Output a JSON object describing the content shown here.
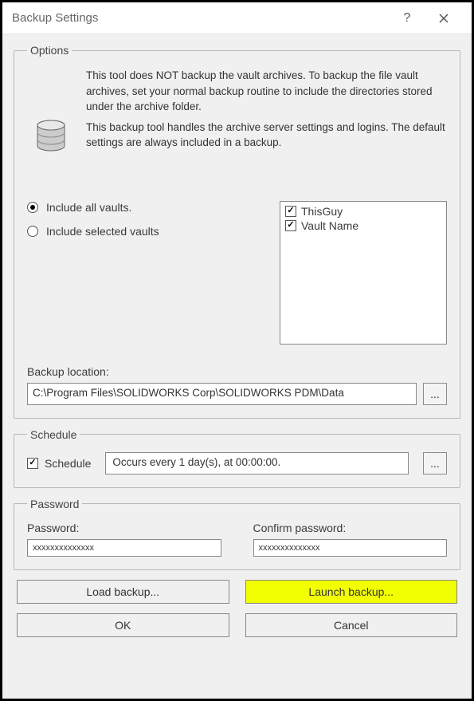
{
  "title": "Backup Settings",
  "options": {
    "legend": "Options",
    "desc1": "This tool does NOT backup the vault archives. To backup the file vault archives, set your normal backup routine to include the directories stored under the archive folder.",
    "desc2": "This backup tool handles the archive server settings and logins. The default settings are always included in a backup.",
    "radio_all": "Include all vaults.",
    "radio_selected": "Include selected vaults",
    "vaults": [
      "ThisGuy",
      "Vault Name"
    ],
    "backup_location_label": "Backup location:",
    "backup_location_value": "C:\\Program Files\\SOLIDWORKS Corp\\SOLIDWORKS PDM\\Data",
    "browse": "..."
  },
  "schedule": {
    "legend": "Schedule",
    "checkbox_label": "Schedule",
    "value": "Occurs every 1 day(s), at 00:00:00.",
    "browse": "..."
  },
  "password": {
    "legend": "Password",
    "pw_label": "Password:",
    "confirm_label": "Confirm password:",
    "mask": "xxxxxxxxxxxxxx"
  },
  "buttons": {
    "load": "Load backup...",
    "launch": "Launch backup...",
    "ok": "OK",
    "cancel": "Cancel"
  }
}
